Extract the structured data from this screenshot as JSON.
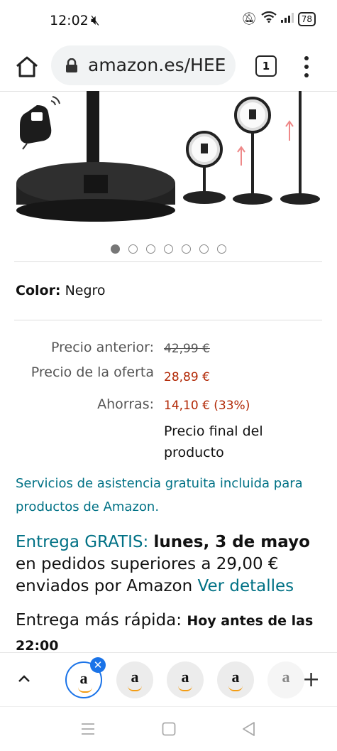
{
  "status": {
    "time": "12:02",
    "battery": "78"
  },
  "browser": {
    "url": "amazon.es/HEE",
    "tab_count": "1"
  },
  "product": {
    "color_label": "Color:",
    "color_value": "Negro",
    "carousel": {
      "count": 7,
      "active": 1
    }
  },
  "pricing": {
    "old_label": "Precio anterior:",
    "old_value": "42,99 €",
    "offer_label": "Precio de la oferta",
    "offer_value": "28,89 €",
    "save_label": "Ahorras:",
    "save_value": "14,10 € (33%)",
    "final_note": "Precio final del producto"
  },
  "services_text": "Servicios de asistencia gratuita incluida para productos de Amazon.",
  "delivery": {
    "free_label": "Entrega GRATIS:",
    "date": "lunes, 3 de mayo",
    "condition": "en pedidos superiores a 29,00 € enviados por Amazon",
    "details_link": "Ver detalles"
  },
  "fast_delivery": {
    "label": "Entrega más rápida:",
    "value": "Hoy antes de las 22:00"
  },
  "tabstrip": {
    "tab_letter": "a",
    "plus": "+"
  },
  "colors": {
    "link": "#007185",
    "price": "#b12704",
    "accent": "#1a73e8"
  }
}
